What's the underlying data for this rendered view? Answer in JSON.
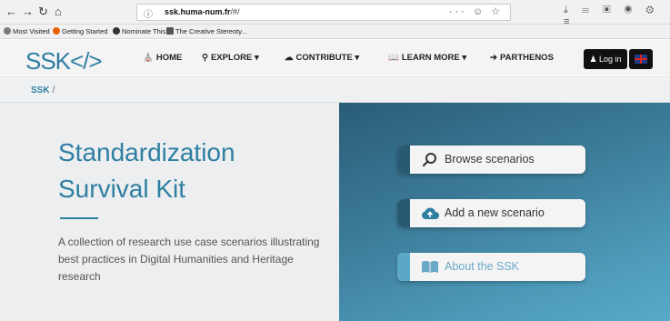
{
  "browser": {
    "url_domain": "ssk.huma-num.fr",
    "url_path": "/#/",
    "url_tail_icons": "··· ☺ ☆",
    "bookmarks": [
      {
        "label": "Most Visited",
        "color": "#7a7a7a"
      },
      {
        "label": "Getting Started",
        "color": "#e66000"
      },
      {
        "label": "Nominate This",
        "color": "#333333"
      },
      {
        "label": "The Creative Stereoty...",
        "color": "#555555"
      }
    ]
  },
  "site": {
    "logo": "SSK</>",
    "menu": {
      "home": "HOME",
      "explore": "EXPLORE",
      "contribute": "CONTRIBUTE",
      "learn_more": "LEARN MORE",
      "parthenos": "PARTHENOS"
    },
    "login": "Log in",
    "breadcrumb": "SSK",
    "breadcrumb_sep": "/"
  },
  "hero": {
    "title_line1": "Standardization",
    "title_line2": "Survival Kit",
    "description": "A collection of research use case scenarios illustrating best practices in Digital Humanities and Heritage research",
    "buttons": {
      "browse": "Browse scenarios",
      "add": "Add a new scenario",
      "about": "About the SSK"
    }
  },
  "colors": {
    "brand_blue": "#2f7fa3",
    "hero_dark": "#2a5d77",
    "hero_light": "#58a9c8"
  }
}
